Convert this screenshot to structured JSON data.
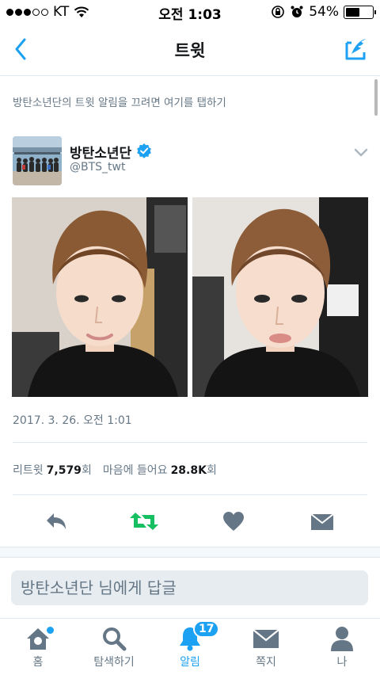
{
  "status_bar": {
    "carrier": "KT",
    "time": "오전 1:03",
    "battery": "54%",
    "battery_level": 0.54
  },
  "nav": {
    "title": "트윗",
    "back_icon": "chevron-left-icon",
    "compose_icon": "compose-icon"
  },
  "notify_text": "방탄소년단의 트윗 알림을 끄려면 여기를 탭하기",
  "tweet": {
    "display_name": "방탄소년단",
    "handle": "@BTS_twt",
    "timestamp": "2017. 3. 26. 오전 1:01",
    "retweets_label": "리트윗",
    "retweets_count": "7,579",
    "likes_label": "마음에 들어요",
    "likes_count": "28.8K",
    "count_suffix": "회"
  },
  "reply": {
    "placeholder": "방탄소년단 님에게 답글"
  },
  "tabbar": {
    "items": [
      {
        "label": "홈",
        "icon": "home-icon"
      },
      {
        "label": "탐색하기",
        "icon": "search-icon"
      },
      {
        "label": "알림",
        "icon": "bell-icon",
        "badge": "17"
      },
      {
        "label": "쪽지",
        "icon": "mail-icon"
      },
      {
        "label": "나",
        "icon": "person-icon"
      }
    ]
  },
  "colors": {
    "accent": "#1da1f2",
    "retweet_green": "#17bf63",
    "icon_gray": "#657786"
  }
}
